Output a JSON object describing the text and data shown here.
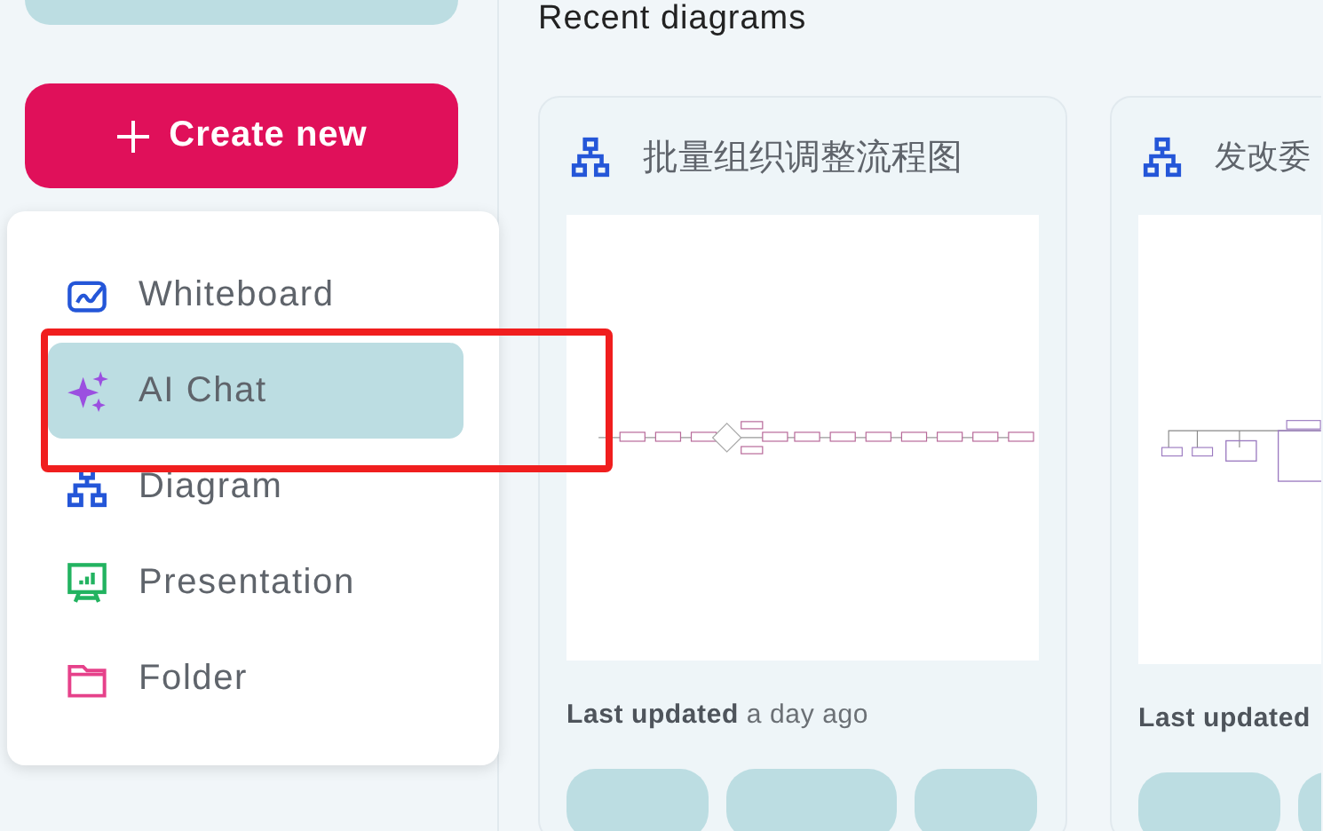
{
  "sidebar": {
    "create_button": {
      "label": "Create new"
    },
    "menu": [
      {
        "label": "Whiteboard",
        "kind": "whiteboard",
        "selected": false
      },
      {
        "label": "AI Chat",
        "kind": "ai",
        "selected": true
      },
      {
        "label": "Diagram",
        "kind": "diagram",
        "selected": false
      },
      {
        "label": "Presentation",
        "kind": "presentation",
        "selected": false
      },
      {
        "label": "Folder",
        "kind": "folder",
        "selected": false
      }
    ]
  },
  "main": {
    "heading": "Recent diagrams",
    "cards": [
      {
        "title": "批量组织调整流程图",
        "kind": "flow",
        "updated": "**Last updated** a day ago"
      },
      {
        "title": "发改委",
        "kind": "tree",
        "updated": "**Last updated**"
      }
    ]
  }
}
